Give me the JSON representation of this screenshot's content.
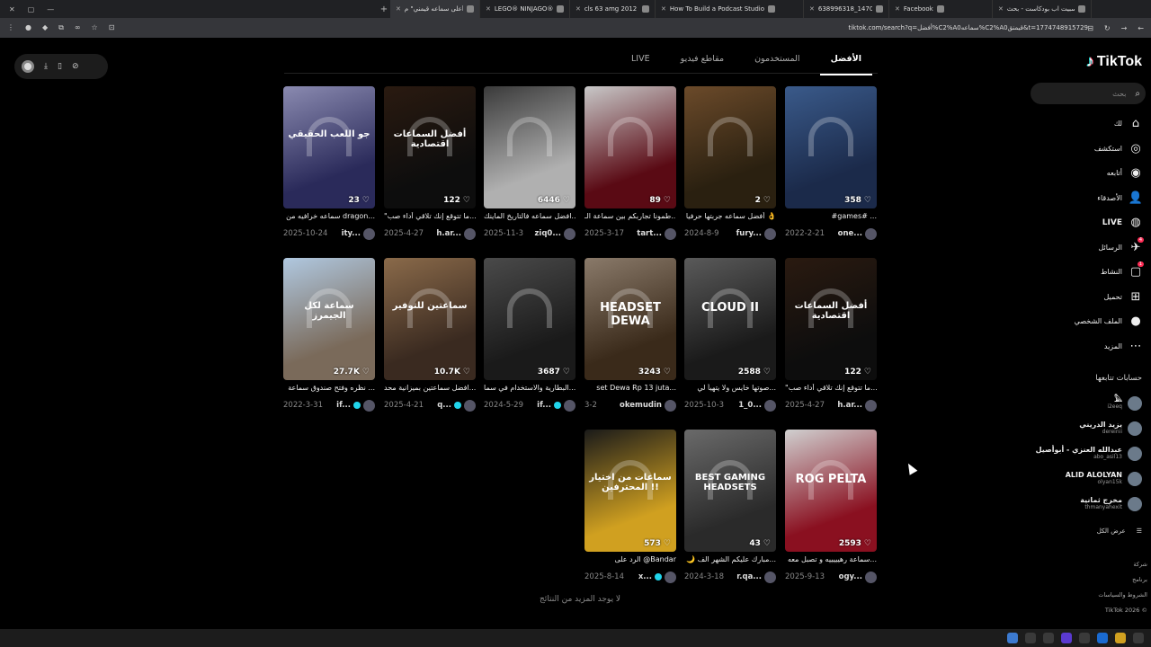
{
  "browser": {
    "tabs": [
      {
        "label": "سبيت اب بودكاست - بحث Google",
        "active": false
      },
      {
        "label": "Facebook",
        "active": false
      },
      {
        "label": "638996318_1470230546698...",
        "active": false
      },
      {
        "label": "How To Build a Podcast Studio",
        "active": false
      },
      {
        "label": "cls 63 amg 2012 - بحث Google",
        "active": false
      },
      {
        "label": "LEGO® NINJAGO® ألعاب و هدايا",
        "active": false
      },
      {
        "label": "اعثر على \"أعلى سماعه قيمني\" م...",
        "active": true
      }
    ],
    "url": "tiktok.com/search?q=أفضل%C2%A0سماعه%C2%A0قيمنق&t=1774748915729"
  },
  "floatbar": {
    "icons": [
      "download-icon",
      "phone-icon",
      "compass-icon"
    ]
  },
  "sidebar": {
    "logo": "TikTok",
    "search_placeholder": "بحث",
    "nav": [
      {
        "label": "لك",
        "icon": "⌂",
        "name": "nav-foryou"
      },
      {
        "label": "استكشف",
        "icon": "◎",
        "name": "nav-explore"
      },
      {
        "label": "أتابعه",
        "icon": "◉",
        "name": "nav-following"
      },
      {
        "label": "الأصدقاء",
        "icon": "👤",
        "name": "nav-friends"
      },
      {
        "label": "LIVE",
        "icon": "◍",
        "name": "nav-live",
        "bold": true
      },
      {
        "label": "الرسائل",
        "icon": "✈",
        "name": "nav-messages",
        "badge": "4"
      },
      {
        "label": "النشاط",
        "icon": "▢",
        "name": "nav-activity",
        "badge": "1"
      },
      {
        "label": "تحميل",
        "icon": "⊞",
        "name": "nav-upload"
      },
      {
        "label": "الملف الشخصي",
        "icon": "●",
        "name": "nav-profile"
      },
      {
        "label": "المزيد",
        "icon": "⋯",
        "name": "nav-more"
      }
    ],
    "following_title": "حسابات تتابعها",
    "accounts": [
      {
        "name": "𓅓",
        "handle": "i2eeq"
      },
      {
        "name": "يزيد الدريني",
        "handle": "dereinii"
      },
      {
        "name": "عبدالله العنزي - أبوأصيل",
        "handle": "abo_asil13"
      },
      {
        "name": "ALID ALOLYAN",
        "handle": "olyan15k"
      },
      {
        "name": "مخرج ثمانية",
        "handle": "thmanyahexit"
      }
    ],
    "see_all": "عرض الكل",
    "footer": [
      "شركة",
      "برنامج",
      "الشروط والسياسات",
      "TikTok 2026 ©"
    ]
  },
  "tabs": [
    {
      "label": "الأفضل",
      "active": true
    },
    {
      "label": "المستخدمون",
      "active": false
    },
    {
      "label": "مقاطع فيديو",
      "active": false
    },
    {
      "label": "LIVE",
      "active": false
    }
  ],
  "videos": [
    {
      "views": "358",
      "desc": "#games# ...",
      "date": "2022-2-21",
      "author": "one...",
      "verified": false,
      "overlay": "",
      "color1": "#1b2a4a",
      "color2": "#3a5a8a"
    },
    {
      "views": "2",
      "desc": "أفضل سماعه جربتها حرفيا 👌",
      "date": "2024-8-9",
      "author": "fury...",
      "verified": false,
      "overlay": "",
      "color1": "#2a2010",
      "color2": "#6b4a2a"
    },
    {
      "views": "89",
      "desc": "طمونا تجاربكم بين سماعة الـ...",
      "date": "2025-3-17",
      "author": "tart...",
      "verified": false,
      "overlay": "",
      "color1": "#5a0a14",
      "color2": "#c8c8c8"
    },
    {
      "views": "6446",
      "desc": "افضل سماعه فالتاريخ الماينك...",
      "date": "2025-11-3",
      "author": "ziq0...",
      "verified": false,
      "overlay": "",
      "color1": "#b0b0b0",
      "color2": "#3a3a3a"
    },
    {
      "views": "122",
      "desc": "\"ما تتوقع إنك تلاقي أداء صب...",
      "date": "2025-4-27",
      "author": "h.ar...",
      "verified": false,
      "overlay": "أفضل السماعات اقتصادية",
      "color1": "#0d0d0d",
      "color2": "#2a1a10"
    },
    {
      "views": "23",
      "desc": "سماعه خرافيه من dragon...",
      "date": "2025-10-24",
      "author": "ity...",
      "verified": false,
      "overlay": "جو اللعب الحقيقي",
      "color1": "#2a2a5a",
      "color2": "#8a8ab0"
    },
    {
      "views": "122",
      "desc": "\"ما تتوقع إنك تلاقي أداء صب...",
      "date": "2025-4-27",
      "author": "h.ar...",
      "verified": false,
      "overlay": "أفضل السماعات اقتصادية",
      "color1": "#0d0d0d",
      "color2": "#2a1a10"
    },
    {
      "views": "2588",
      "desc": "صوتها خايس ولا يتهيأ لي...",
      "date": "2025-10-3",
      "author": "1_0...",
      "verified": false,
      "overlay": "CLOUD II",
      "color1": "#1a1a1a",
      "color2": "#5a5a5a"
    },
    {
      "views": "3243",
      "desc": "set Dewa Rp 13 juta...",
      "date": "3-2",
      "author": "okemudin",
      "verified": false,
      "overlay": "HEADSET DEWA",
      "color1": "#3a2a1a",
      "color2": "#8a7a6a"
    },
    {
      "views": "3687",
      "desc": "البطارية والاستخدام في سما...",
      "date": "2024-5-29",
      "author": "if...",
      "verified": true,
      "overlay": "",
      "color1": "#1a1a1a",
      "color2": "#4a4a4a"
    },
    {
      "views": "10.7K",
      "desc": "افضل سماعتين بميزانية محد...",
      "date": "2025-4-21",
      "author": "q...",
      "verified": true,
      "overlay": "سماعتين للتوفير",
      "color1": "#3a2a20",
      "color2": "#8a6a4a"
    },
    {
      "views": "27.7K",
      "desc": "نظره وفتح صندوق سماعة ...",
      "date": "2022-3-31",
      "author": "if...",
      "verified": true,
      "overlay": "سماعة لكل الجيمرز",
      "color1": "#7a6a5a",
      "color2": "#b0c8e0"
    },
    {
      "views": "2593",
      "desc": "سماعة رهيييييه و تصبل معه...",
      "date": "2025-9-13",
      "author": "ogy...",
      "verified": false,
      "overlay": "ROG PELTA",
      "color1": "#8a1020",
      "color2": "#d0d0d0"
    },
    {
      "views": "43",
      "desc": "🌙 مبارك عليكم الشهر الف...",
      "date": "2024-3-18",
      "author": "r.qa...",
      "verified": false,
      "overlay": "BEST GAMING HEADSETS",
      "color1": "#2a2a2a",
      "color2": "#6a6a6a"
    },
    {
      "views": "573",
      "desc": "الرد على @Bandar",
      "date": "2025-8-14",
      "author": "x...",
      "verified": true,
      "overlay": "سماعات من اختيار المحترفين !!",
      "color1": "#d0a020",
      "color2": "#1a1a1a"
    }
  ],
  "no_more": "لا يوجد المزيد من النتائج"
}
